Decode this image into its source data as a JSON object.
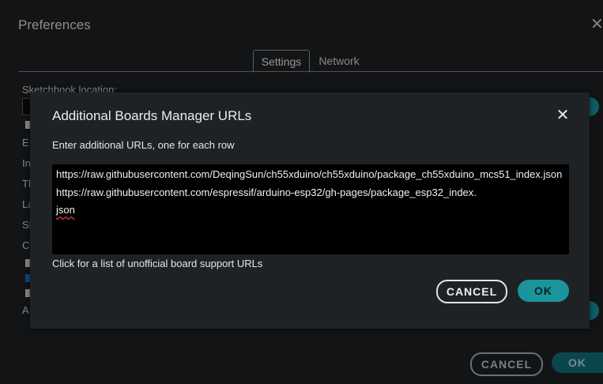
{
  "preferences": {
    "title": "Preferences",
    "tabs": [
      {
        "label": "Settings"
      },
      {
        "label": "Network"
      }
    ],
    "partial_labels": [
      "Sketchbook location:",
      "E",
      "In",
      "Th",
      "La",
      "Sh",
      "C",
      "A"
    ],
    "cancel_label": "CANCEL",
    "ok_label": "OK"
  },
  "dialog": {
    "title": "Additional Boards Manager URLs",
    "instruction": "Enter additional URLs, one for each row",
    "url_lines": [
      "https://raw.githubusercontent.com/DeqingSun/ch55xduino/ch55xduino/package_ch55xduino_mcs51_index.json",
      "https://raw.githubusercontent.com/espressif/arduino-esp32/gh-pages/package_esp32_index.",
      "json"
    ],
    "link_text": "Click for a list of unofficial board support URLs",
    "cancel_label": "CANCEL",
    "ok_label": "OK"
  },
  "colors": {
    "accent": "#1a949d",
    "background": "#1c1f22",
    "dialog_bg": "#1f2225",
    "field_bg": "#000000"
  }
}
